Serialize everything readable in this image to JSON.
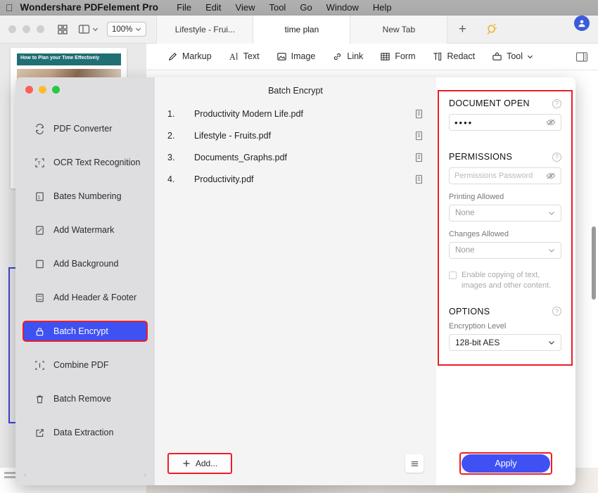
{
  "menubar": {
    "apple_icon": "apple-logo-icon",
    "app_name": "Wondershare PDFelement Pro",
    "items": [
      "File",
      "Edit",
      "View",
      "Tool",
      "Go",
      "Window",
      "Help"
    ]
  },
  "tabstrip": {
    "grid_icon": "grid-view-icon",
    "panel_icon": "sidebar-panel-icon",
    "panel_chevron": "chevron-down-icon",
    "zoom_value": "100%",
    "zoom_chevron": "chevron-down-icon",
    "tabs": [
      {
        "label": "Lifestyle - Frui...",
        "active": false
      },
      {
        "label": "time plan",
        "active": true
      },
      {
        "label": "New Tab",
        "active": false
      }
    ],
    "new_tab_icon": "plus-icon",
    "bulb_icon": "idea-bulb-icon",
    "avatar_icon": "user-avatar-icon"
  },
  "ribbon": {
    "items": [
      {
        "label": "Markup",
        "icon": "pen-markup-icon",
        "chevron": false
      },
      {
        "label": "Text",
        "icon": "text-cursor-icon",
        "chevron": false
      },
      {
        "label": "Image",
        "icon": "image-icon",
        "chevron": false
      },
      {
        "label": "Link",
        "icon": "link-icon",
        "chevron": false
      },
      {
        "label": "Form",
        "icon": "form-grid-icon",
        "chevron": false
      },
      {
        "label": "Redact",
        "icon": "redact-icon",
        "chevron": false
      },
      {
        "label": "Tool",
        "icon": "toolbox-icon",
        "chevron": true
      }
    ],
    "right_panel_icon": "toggle-right-panel-icon"
  },
  "background": {
    "thumbnail_banner_text": "How to Plan your Time Effectively"
  },
  "modal": {
    "window_controls": [
      "close",
      "minimize",
      "zoom"
    ],
    "title": "Batch Encrypt",
    "sidebar_items": [
      {
        "label": "PDF Converter",
        "icon": "convert-refresh-icon",
        "selected": false
      },
      {
        "label": "OCR Text Recognition",
        "icon": "ocr-text-icon",
        "selected": false
      },
      {
        "label": "Bates Numbering",
        "icon": "bates-numbering-icon",
        "selected": false
      },
      {
        "label": "Add Watermark",
        "icon": "watermark-icon",
        "selected": false
      },
      {
        "label": "Add Background",
        "icon": "background-square-icon",
        "selected": false
      },
      {
        "label": "Add Header & Footer",
        "icon": "header-footer-icon",
        "selected": false
      },
      {
        "label": "Batch Encrypt",
        "icon": "lock-icon",
        "selected": true
      },
      {
        "label": "Combine PDF",
        "icon": "combine-icon",
        "selected": false
      },
      {
        "label": "Batch Remove",
        "icon": "trash-icon",
        "selected": false
      },
      {
        "label": "Data Extraction",
        "icon": "extract-arrow-icon",
        "selected": false
      }
    ],
    "files": [
      {
        "num": "1.",
        "name": "Productivity Modern Life.pdf",
        "icon": "pdf-file-icon"
      },
      {
        "num": "2.",
        "name": "Lifestyle - Fruits.pdf",
        "icon": "pdf-file-icon"
      },
      {
        "num": "3.",
        "name": "Documents_Graphs.pdf",
        "icon": "pdf-file-icon"
      },
      {
        "num": "4.",
        "name": "Productivity.pdf",
        "icon": "pdf-file-icon"
      }
    ],
    "add_button": {
      "label": "Add...",
      "icon": "plus-icon"
    },
    "list_options_icon": "hamburger-menu-icon",
    "panel": {
      "document_open": {
        "heading": "DOCUMENT OPEN",
        "help_icon": "question-mark-icon",
        "password_value": "••••",
        "reveal_icon": "eye-slash-icon"
      },
      "permissions": {
        "heading": "PERMISSIONS",
        "help_icon": "question-mark-icon",
        "password_placeholder": "Permissions Password",
        "reveal_icon": "eye-slash-icon",
        "printing_label": "Printing Allowed",
        "printing_value": "None",
        "changes_label": "Changes Allowed",
        "changes_value": "None",
        "copy_checkbox_label": "Enable copying of text, images and other content.",
        "copy_checked": false
      },
      "options": {
        "heading": "OPTIONS",
        "help_icon": "question-mark-icon",
        "encryption_label": "Encryption Level",
        "encryption_value": "128-bit AES"
      },
      "chevron_icon": "chevron-down-icon"
    },
    "apply_button": {
      "label": "Apply"
    }
  },
  "colors": {
    "accent_blue": "#3f51f3",
    "highlight_red": "#ee1c25",
    "menubar_gray": "#aaaaaa",
    "modal_sidebar": "#dedee0"
  }
}
